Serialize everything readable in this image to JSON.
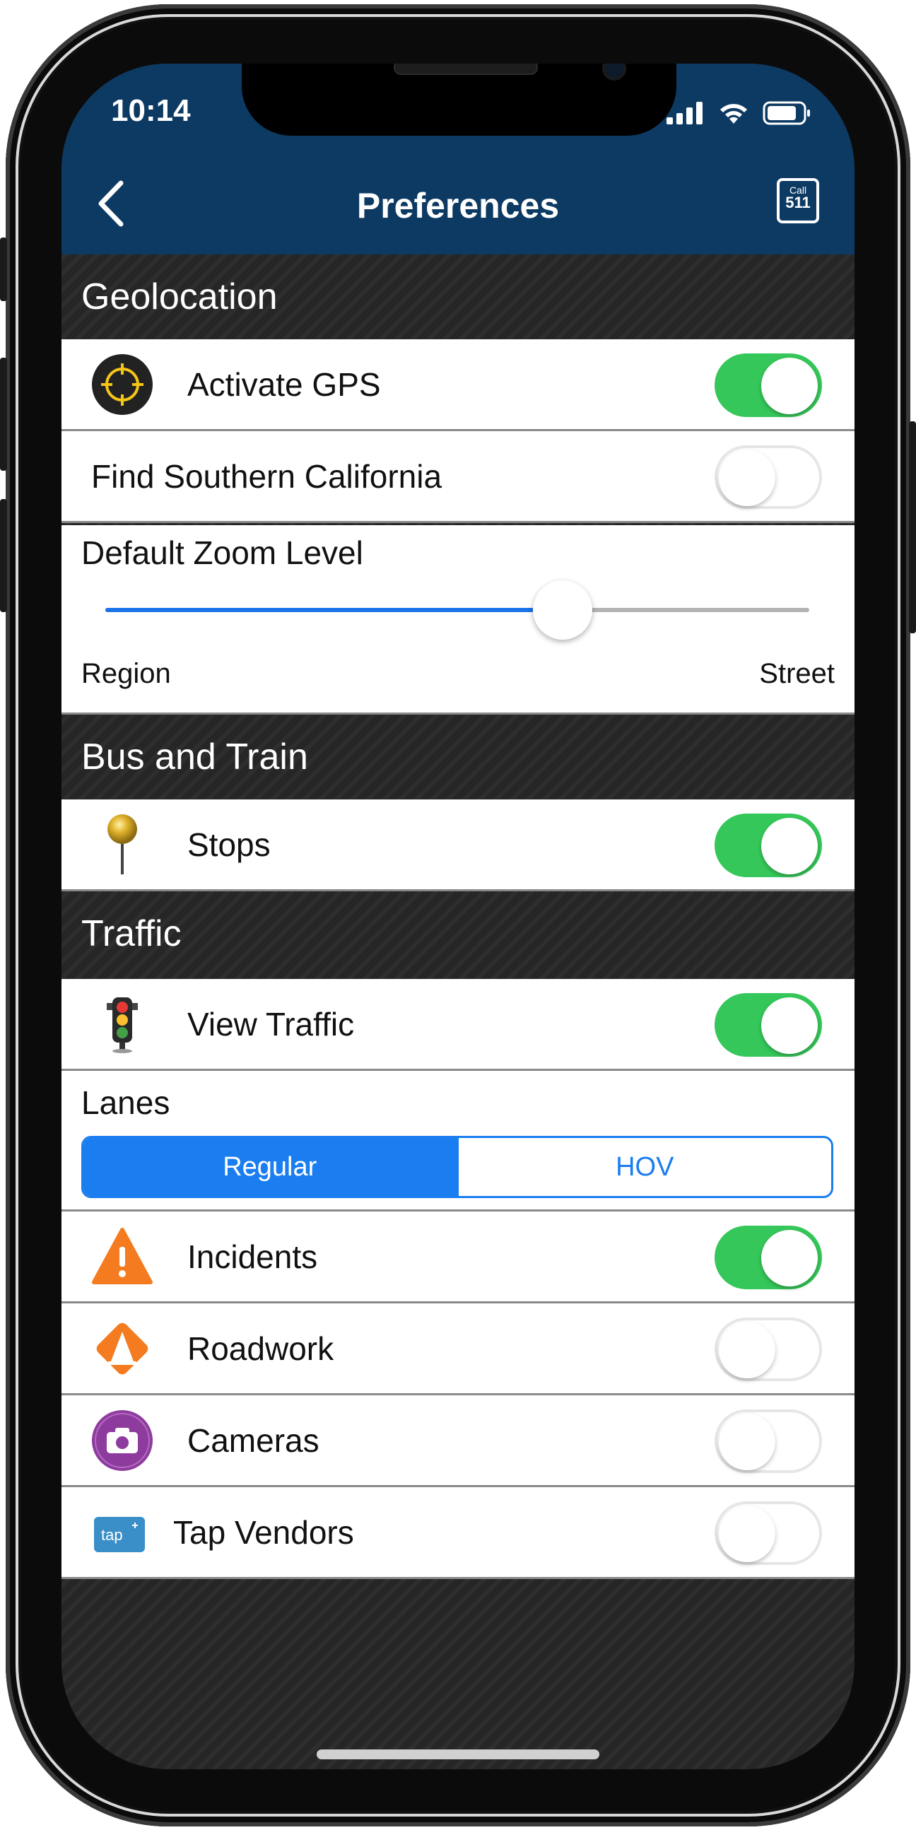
{
  "status_bar": {
    "time": "10:14"
  },
  "nav": {
    "title": "Preferences",
    "call_line1": "Call",
    "call_line2": "511"
  },
  "sections": {
    "geolocation": "Geolocation",
    "bus_train": "Bus and Train",
    "traffic": "Traffic"
  },
  "geolocation": {
    "activate_gps": {
      "label": "Activate GPS",
      "on": true
    },
    "find_socal": {
      "label": "Find Southern California",
      "on": false
    }
  },
  "zoom": {
    "title": "Default Zoom Level",
    "min_label": "Region",
    "max_label": "Street",
    "value": 0.65
  },
  "bus_train": {
    "stops": {
      "label": "Stops",
      "on": true
    }
  },
  "traffic": {
    "view_traffic": {
      "label": "View Traffic",
      "on": true
    },
    "lanes_title": "Lanes",
    "lanes_options": [
      "Regular",
      "HOV"
    ],
    "lanes_selected": "Regular",
    "incidents": {
      "label": "Incidents",
      "on": true
    },
    "roadwork": {
      "label": "Roadwork",
      "on": false
    },
    "cameras": {
      "label": "Cameras",
      "on": false
    },
    "tap_vendors": {
      "label": "Tap Vendors",
      "on": false
    },
    "tap_logo": "tap"
  },
  "colors": {
    "header": "#0d3a63",
    "toggle_on": "#35c759",
    "accent_blue": "#1a7df0"
  }
}
